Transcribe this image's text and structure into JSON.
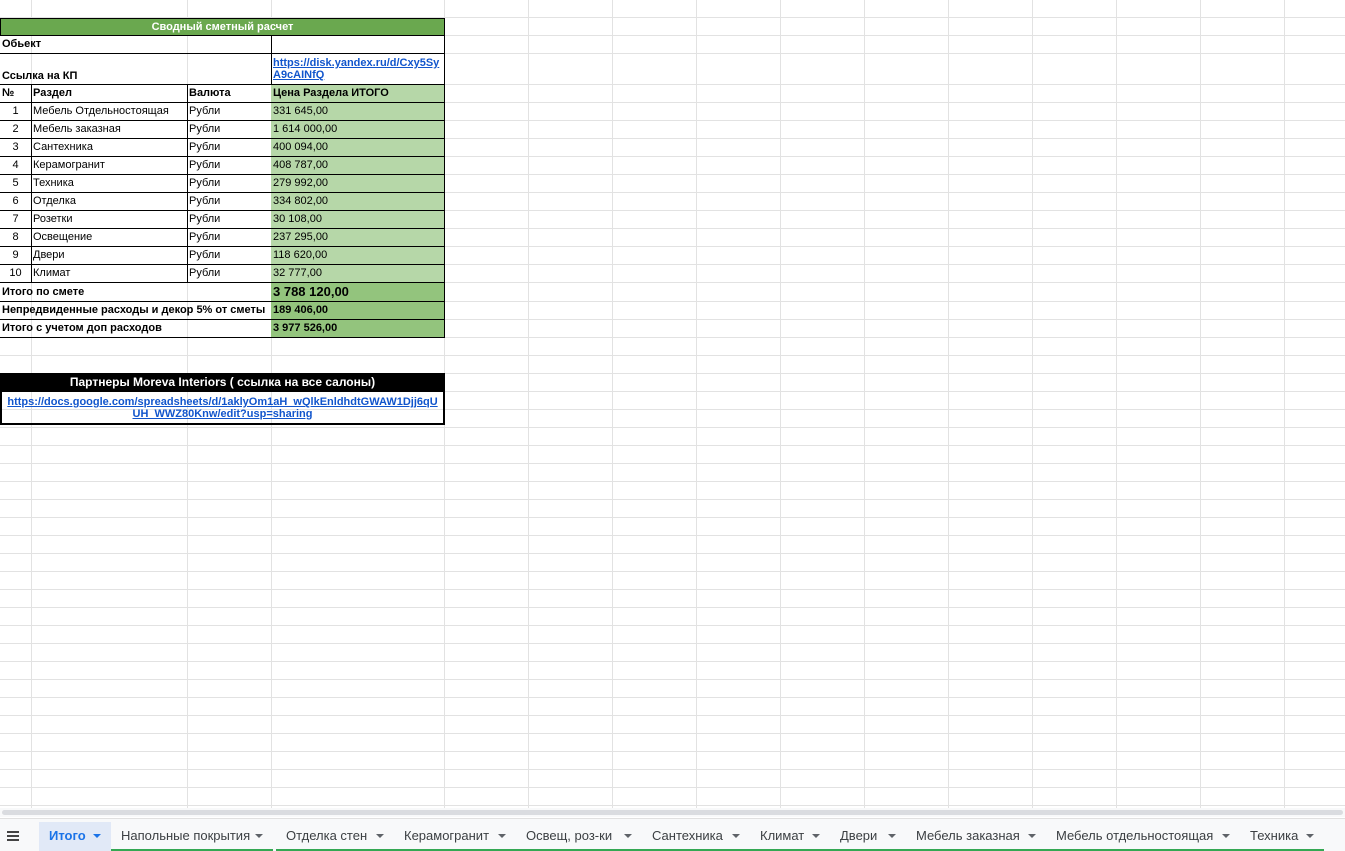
{
  "estimate": {
    "title": "Сводный сметный расчет",
    "object_label": "Обьект",
    "object_value": "",
    "kp_label": "Ссылка на КП",
    "kp_link": "https://disk.yandex.ru/d/Cxy5SyA9cAINfQ",
    "headers": {
      "num": "№",
      "section": "Раздел",
      "currency": "Валюта",
      "price": "Цена Раздела ИТОГО"
    },
    "rows": [
      {
        "num": "1",
        "section": "Мебель Отдельностоящая",
        "currency": "Рубли",
        "price": "331 645,00"
      },
      {
        "num": "2",
        "section": "Мебель заказная",
        "currency": "Рубли",
        "price": "1 614 000,00"
      },
      {
        "num": "3",
        "section": "Сантехника",
        "currency": "Рубли",
        "price": "400 094,00"
      },
      {
        "num": "4",
        "section": "Керамогранит",
        "currency": "Рубли",
        "price": "408 787,00"
      },
      {
        "num": "5",
        "section": "Техника",
        "currency": "Рубли",
        "price": "279 992,00"
      },
      {
        "num": "6",
        "section": "Отделка",
        "currency": "Рубли",
        "price": "334 802,00"
      },
      {
        "num": "7",
        "section": "Розетки",
        "currency": "Рубли",
        "price": "30 108,00"
      },
      {
        "num": "8",
        "section": "Освещение",
        "currency": "Рубли",
        "price": "237 295,00"
      },
      {
        "num": "9",
        "section": "Двери",
        "currency": "Рубли",
        "price": "118 620,00"
      },
      {
        "num": "10",
        "section": "Климат",
        "currency": "Рубли",
        "price": "32 777,00"
      }
    ],
    "total_label": "Итого по смете",
    "total_value": "3 788 120,00",
    "extra_label": "Непредвиденные расходы и декор 5% от сметы",
    "extra_value": "189 406,00",
    "grand_label": "Итого с учетом доп расходов",
    "grand_value": "3 977 526,00"
  },
  "partners": {
    "title": "Партнеры Moreva Interiors ( ссылка на все салоны)",
    "link": "https://docs.google.com/spreadsheets/d/1aklyOm1aH_wQlkEnldhdtGWAW1Djj6qUUH_WWZ80Knw/edit?usp=sharing"
  },
  "tabs": [
    {
      "label": "Итого",
      "active": true
    },
    {
      "label": "Напольные покрытия"
    },
    {
      "label": "Отделка стен"
    },
    {
      "label": "Керамогранит"
    },
    {
      "label": "Освещ, роз-ки"
    },
    {
      "label": "Сантехника"
    },
    {
      "label": "Климат"
    },
    {
      "label": "Двери"
    },
    {
      "label": "Мебель заказная"
    },
    {
      "label": "Мебель отдельностоящая"
    },
    {
      "label": "Техника"
    }
  ],
  "colors": {
    "header_green": "#6aa84f",
    "light_green": "#b6d7a8",
    "mid_green": "#93c47d",
    "link_blue": "#1155cc",
    "tab_active": "#1a73e8"
  }
}
